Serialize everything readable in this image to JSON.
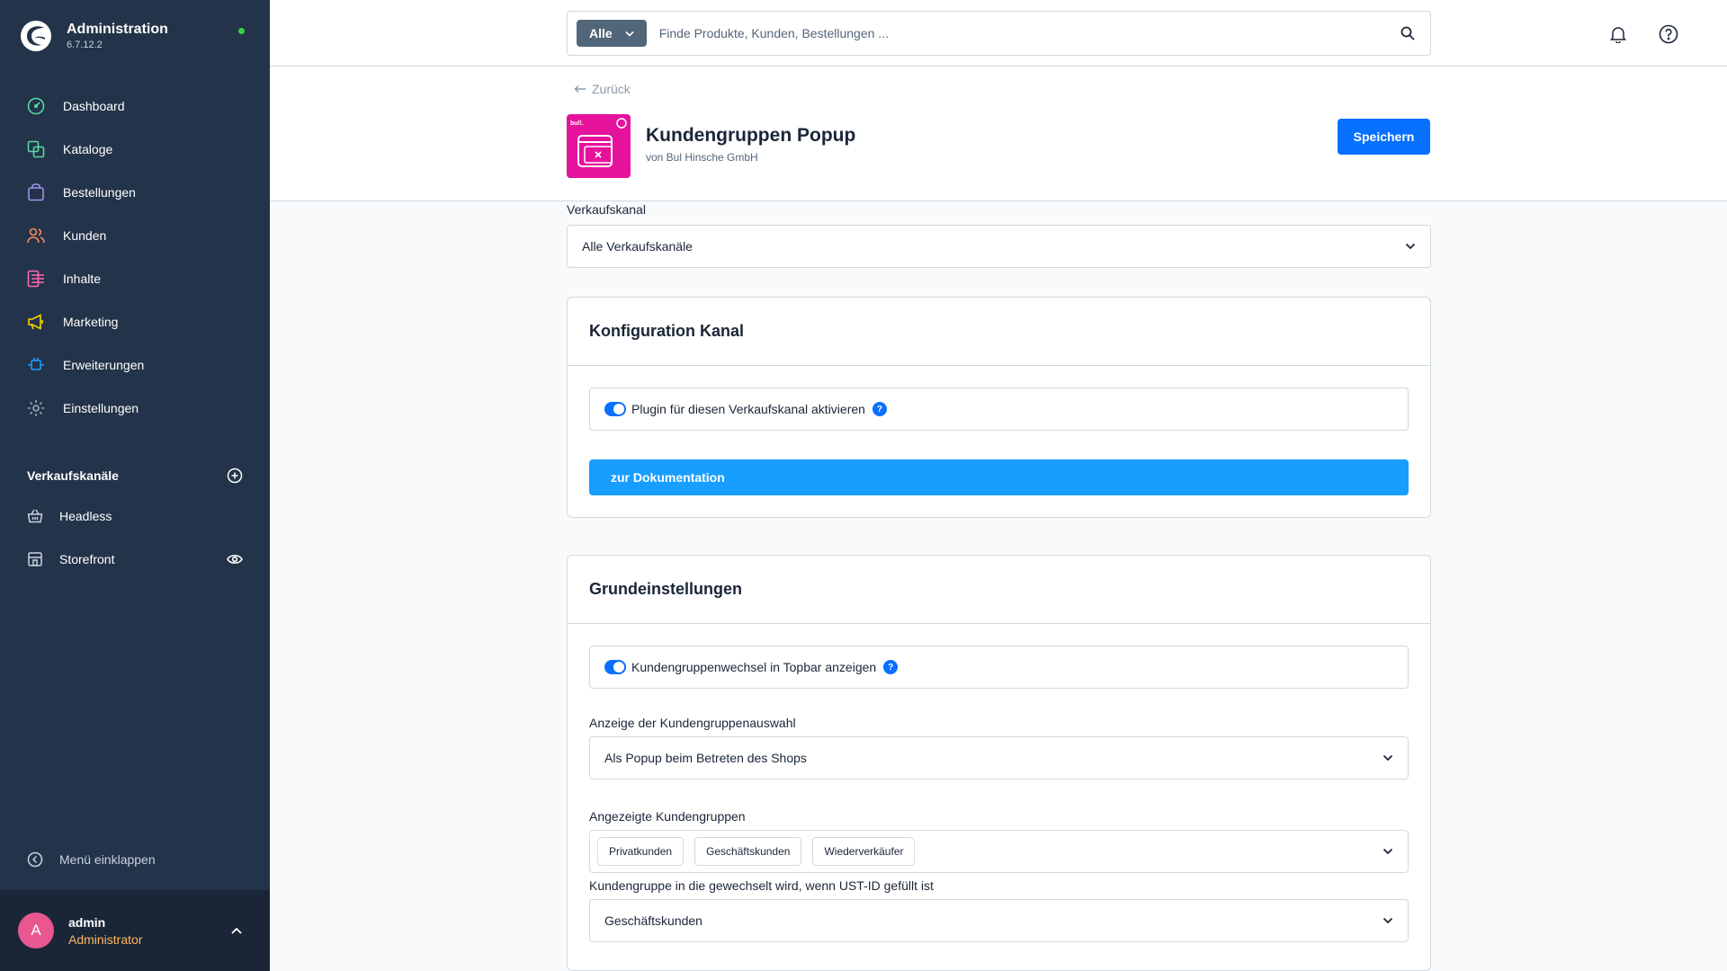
{
  "app": {
    "title": "Administration",
    "version": "6.7.12.2"
  },
  "sidebar": {
    "nav": [
      {
        "label": "Dashboard",
        "icon": "dashboard-icon",
        "color": "#57d9a3"
      },
      {
        "label": "Kataloge",
        "icon": "catalog-icon",
        "color": "#57d9a3"
      },
      {
        "label": "Bestellungen",
        "icon": "orders-icon",
        "color": "#a092f0"
      },
      {
        "label": "Kunden",
        "icon": "customers-icon",
        "color": "#f88962"
      },
      {
        "label": "Inhalte",
        "icon": "content-icon",
        "color": "#ff68b4"
      },
      {
        "label": "Marketing",
        "icon": "marketing-icon",
        "color": "#ffd700"
      },
      {
        "label": "Erweiterungen",
        "icon": "extensions-icon",
        "color": "#189eff"
      },
      {
        "label": "Einstellungen",
        "icon": "settings-icon",
        "color": "#9aa8b5"
      }
    ],
    "channels_heading": "Verkaufskanäle",
    "channels": [
      {
        "label": "Headless",
        "icon": "basket-icon"
      },
      {
        "label": "Storefront",
        "icon": "storefront-icon"
      }
    ],
    "collapse_label": "Menü einklappen",
    "user": {
      "initial": "A",
      "name": "admin",
      "role": "Administrator"
    }
  },
  "search": {
    "type_label": "Alle",
    "placeholder": "Finde Produkte, Kunden, Bestellungen ..."
  },
  "page": {
    "back_label": "Zurück",
    "title": "Kundengruppen Popup",
    "vendor": "von Bul Hinsche GmbH",
    "save_label": "Speichern"
  },
  "sales_channel": {
    "label": "Verkaufskanal",
    "value": "Alle Verkaufskanäle"
  },
  "card_channel": {
    "title": "Konfiguration Kanal",
    "toggle_label": "Plugin für diesen Verkaufskanal aktivieren",
    "toggle_on": true,
    "doc_button": "zur Dokumentation"
  },
  "card_basic": {
    "title": "Grundeinstellungen",
    "toggle_label": "Kundengruppenwechsel in Topbar anzeigen",
    "toggle_on": true,
    "display_label": "Anzeige der Kundengruppenauswahl",
    "display_value": "Als Popup beim Betreten des Shops",
    "groups_label": "Angezeigte Kundengruppen",
    "groups": [
      "Privatkunden",
      "Geschäftskunden",
      "Wiederverkäufer"
    ],
    "vat_label": "Kundengruppe in die gewechselt wird, wenn UST-ID gefüllt ist",
    "vat_value": "Geschäftskunden"
  },
  "colors": {
    "sidebar_bg": "#233349",
    "primary": "#0870ff",
    "doc_button": "#189eff",
    "plugin_icon_bg": "#e5129c",
    "online_dot": "#37d046",
    "role_text": "#ffb75d",
    "avatar_bg": "#e8578f"
  }
}
